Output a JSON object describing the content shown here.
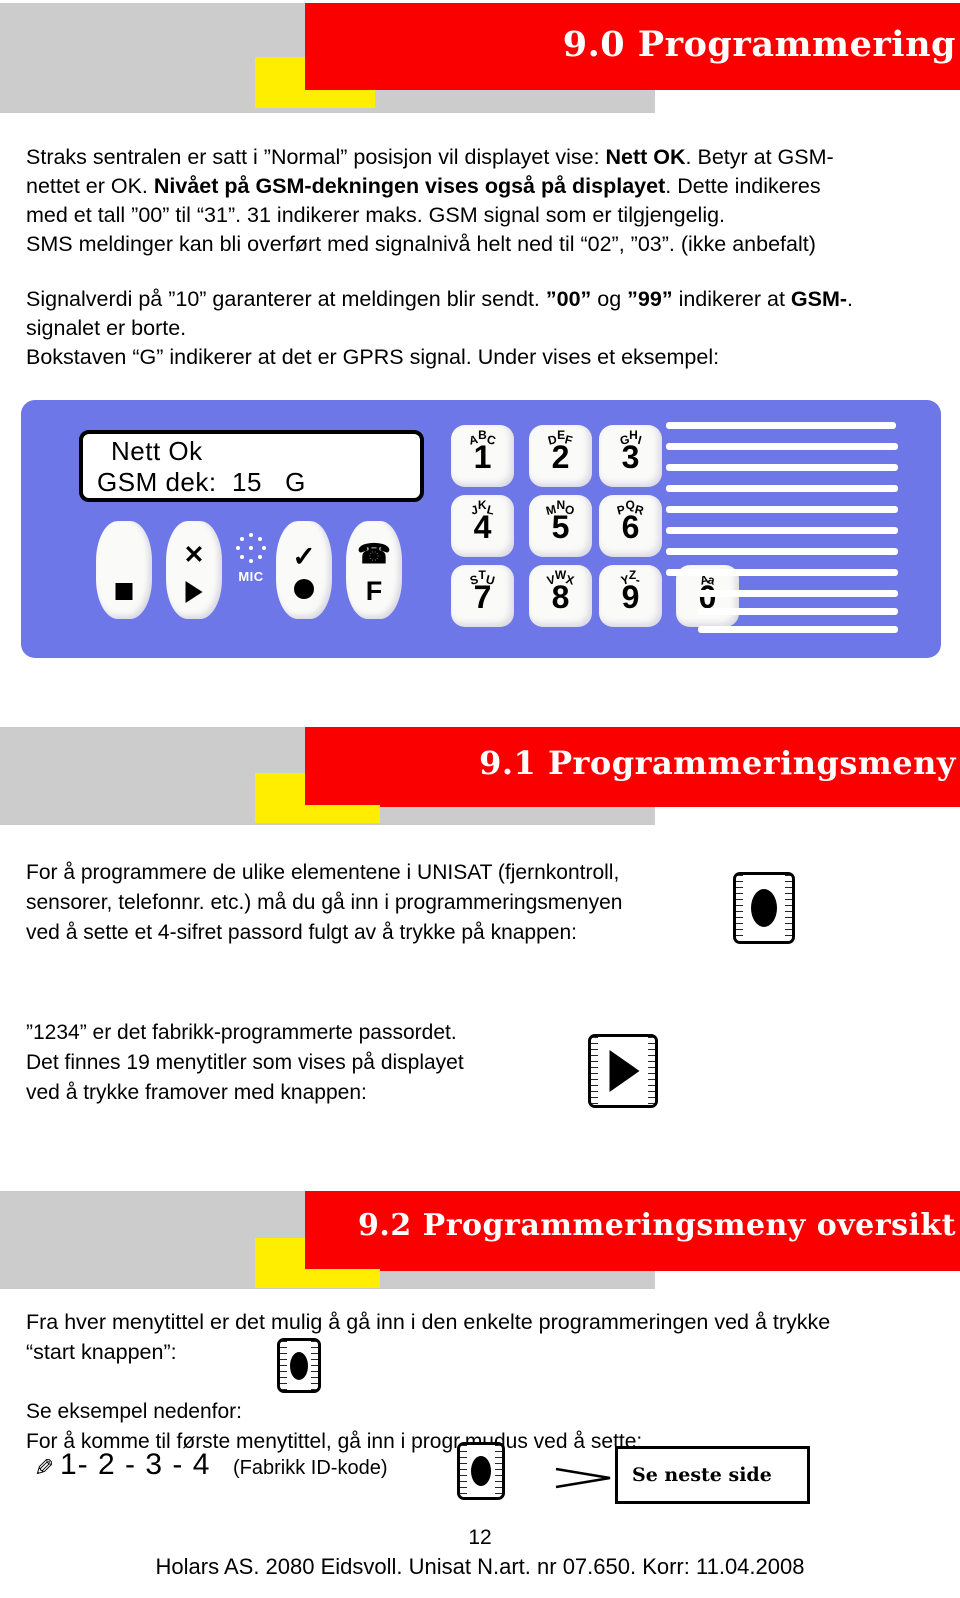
{
  "sections": {
    "s90": {
      "title": "9.0 Programmering"
    },
    "s91": {
      "title": "9.1 Programmeringsmeny"
    },
    "s92": {
      "title": "9.2 Programmeringsmeny oversikt"
    }
  },
  "paragraph1": {
    "line1_a": "Straks sentralen er satt i ”Normal” posisjon vil displayet vise: ",
    "line1_b": "Nett OK",
    "line1_c": ". Betyr at GSM-",
    "line2_a": "nettet er OK. ",
    "line2_b": "Nivået på GSM-dekningen vises også på displayet",
    "line2_c": ". Dette indikeres",
    "line3": "med et tall ”00”  til “31”. 31 indikerer maks. GSM signal som er tilgjengelig.",
    "line4": "SMS meldinger kan bli overført med signalnivå helt ned til  “02”, ”03”. (ikke anbefalt)"
  },
  "paragraph2": {
    "line1_a": "Signalverdi på ”10” garanterer at meldingen blir sendt. ",
    "line1_b": "”00”",
    "line1_c": " og  ",
    "line1_d": "”99”",
    "line1_e": "  indikerer at  ",
    "line1_f": "GSM-",
    "line1_g": ".",
    "line2": "signalet er borte.",
    "line3": "Bokstaven “G”  indikerer at det er GPRS signal.   Under vises et eksempel:"
  },
  "device": {
    "lcd_line1": "Nett Ok",
    "lcd_line2": "GSM dek:  15   G",
    "mic_label": "MIC",
    "function_keys": [
      {
        "name": "stop-key",
        "glyphs": [
          "square"
        ]
      },
      {
        "name": "cancel-forward-key",
        "glyphs": [
          "X",
          "play"
        ]
      },
      {
        "name": "confirm-record-key",
        "glyphs": [
          "check",
          "circle"
        ]
      },
      {
        "name": "phone-function-key",
        "glyphs": [
          "phone",
          "F"
        ]
      }
    ],
    "keypad": [
      {
        "digit": "1",
        "letters": [
          "A",
          "B",
          "C"
        ]
      },
      {
        "digit": "2",
        "letters": [
          "D",
          "E",
          "F"
        ]
      },
      {
        "digit": "3",
        "letters": [
          "G",
          "H",
          "I"
        ]
      },
      {
        "digit": "4",
        "letters": [
          "J",
          "K",
          "L"
        ]
      },
      {
        "digit": "5",
        "letters": [
          "M",
          "N",
          "O"
        ]
      },
      {
        "digit": "6",
        "letters": [
          "P",
          "Q",
          "R"
        ]
      },
      {
        "digit": "7",
        "letters": [
          "S",
          "T",
          "U"
        ]
      },
      {
        "digit": "8",
        "letters": [
          "V",
          "W",
          "X"
        ]
      },
      {
        "digit": "9",
        "letters": [
          "Y",
          "Z",
          "-"
        ]
      },
      {
        "digit": "0",
        "letters": [
          "A",
          "",
          "a"
        ]
      }
    ]
  },
  "paragraph3": {
    "line1": "For å programmere de ulike elementene i UNISAT (fjernkontroll,",
    "line2": "sensorer, telefonnr. etc.) må du gå inn i programmeringsmenyen",
    "line3": " ved å sette et 4-sifret passord fulgt av å trykke på knappen:"
  },
  "paragraph4": {
    "line1": "”1234” er det fabrikk-programmerte passordet.",
    "line2": "Det finnes 19 menytitler som vises på  displayet",
    "line3": "ved å trykke framover med knappen:"
  },
  "paragraph5": {
    "line1": "Fra hver menytittel er det mulig å gå inn i den enkelte programmeringen ved å trykke",
    "line2": "“start knappen”:"
  },
  "paragraph6": {
    "line1": "Se eksempel nedenfor:",
    "line2": "For å komme til første menytittel, gå inn i progr.mudus ved å sette:"
  },
  "code_row": {
    "hand_glyph": "✎",
    "digits": "1- 2 - 3 - 4",
    "note": "(Fabrikk ID-kode)",
    "next_page": "Se neste side"
  },
  "footer": {
    "page_number": "12",
    "imprint": "Holars AS. 2080 Eidsvoll.  Unisat  N.art. nr 07.650. Korr: 11.04.2008"
  },
  "colors": {
    "red": "#fa0000",
    "gray": "#cccccc",
    "yellow": "#ffee00",
    "device_blue": "#6e77e8"
  }
}
